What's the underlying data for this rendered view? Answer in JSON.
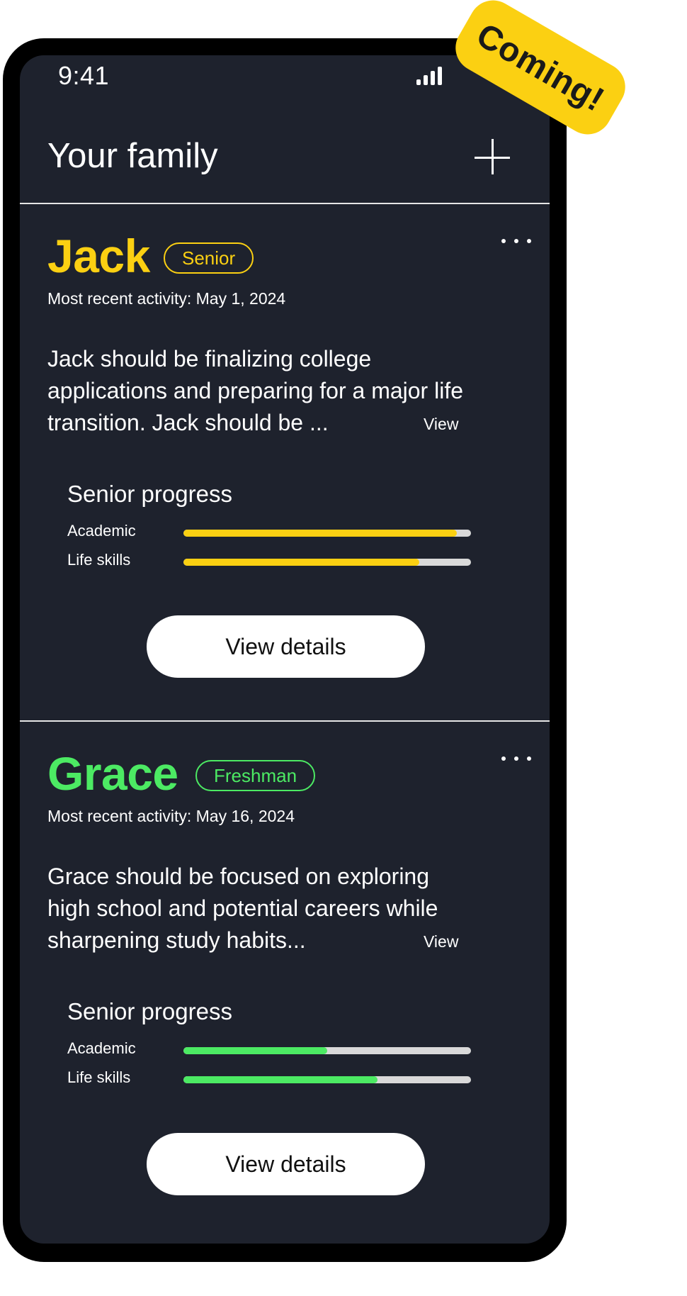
{
  "status_bar": {
    "time": "9:41",
    "signal_icon": "cellular-signal-icon"
  },
  "badge": {
    "label": "Coming!",
    "color": "#fbd012"
  },
  "header": {
    "title": "Your family",
    "add_icon": "plus-icon"
  },
  "children": [
    {
      "name": "Jack",
      "grade": "Senior",
      "accent_color": "#fbd012",
      "recent_activity": "Most recent activity: May 1, 2024",
      "summary_lines": [
        "Jack should be finalizing college",
        "applications and preparing for a major life",
        "transition. Jack should be ..."
      ],
      "view_label": "View",
      "progress_title": "Senior progress",
      "progress": [
        {
          "label": "Academic",
          "value": 0.95
        },
        {
          "label": "Life skills",
          "value": 0.82
        }
      ],
      "button_label": "View details"
    },
    {
      "name": "Grace",
      "grade": "Freshman",
      "accent_color": "#4cea63",
      "recent_activity": "Most recent activity: May 16, 2024",
      "summary_lines": [
        "Grace should be focused on exploring",
        "high school and potential careers while",
        "sharpening study habits..."
      ],
      "view_label": "View",
      "progress_title": "Senior progress",
      "progress": [
        {
          "label": "Academic",
          "value": 0.5
        },
        {
          "label": "Life skills",
          "value": 0.675
        }
      ],
      "button_label": "View details"
    }
  ],
  "colors": {
    "screen_bg": "#1e222d",
    "track": "#d9d9d9"
  }
}
